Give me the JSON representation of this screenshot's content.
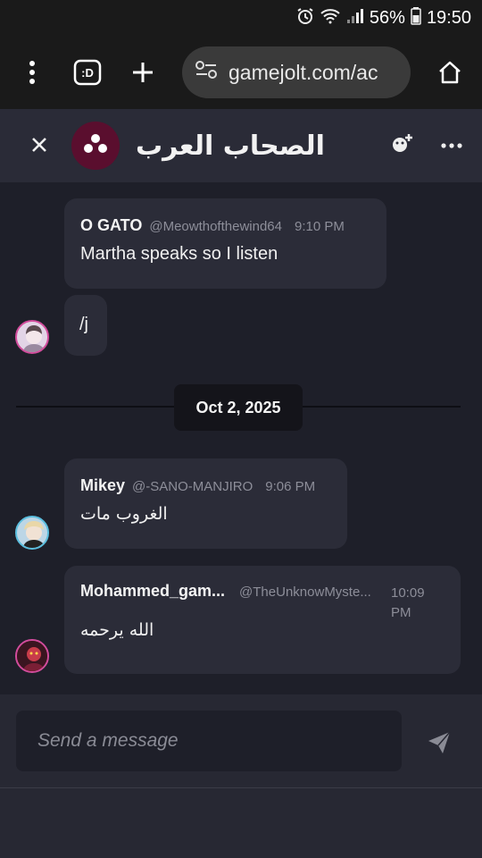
{
  "status_bar": {
    "battery": "56%",
    "time": "19:50"
  },
  "browser": {
    "url": "gamejolt.com/ac",
    "tab_icon_label": ":D"
  },
  "chat": {
    "title": "الصحاب العرب",
    "composer_placeholder": "Send a message",
    "date_separator": "Oct 2, 2025",
    "messages": [
      {
        "author": "O GATO",
        "handle": "@Meowthofthewind64",
        "time": "9:10 PM",
        "text": "Martha speaks so I listen"
      },
      {
        "text": "/j"
      },
      {
        "author": "Mikey",
        "handle": "@-SANO-MANJIRO",
        "time": "9:06 PM",
        "text": "الغروب مات"
      },
      {
        "author": "Mohammed_gam...",
        "handle": "@TheUnknowMyste...",
        "time": "10:09 PM",
        "text": "الله يرحمه"
      }
    ]
  },
  "colors": {
    "background": "#1e1f29",
    "bubble": "#2b2c38",
    "header": "#2a2b37",
    "group_avatar": "#5a0e2e"
  },
  "icons": [
    "alarm-icon",
    "wifi-icon",
    "signal-icon",
    "battery-icon",
    "menu-dots-icon",
    "tab-switcher-icon",
    "new-tab-icon",
    "site-settings-icon",
    "home-icon",
    "close-icon",
    "group-icon",
    "add-member-icon",
    "more-options-icon",
    "send-icon"
  ]
}
